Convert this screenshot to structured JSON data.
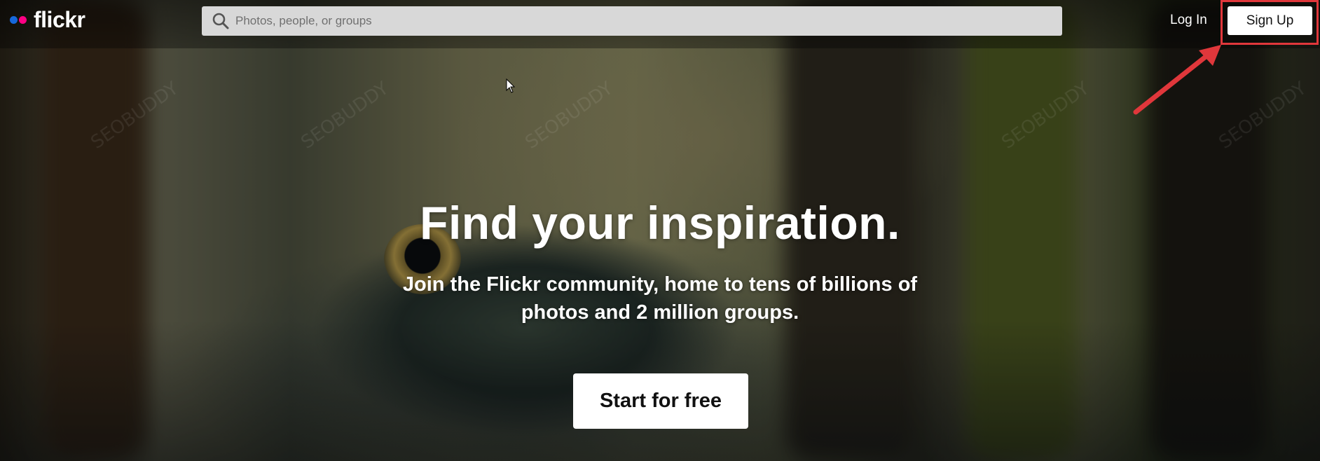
{
  "brand": {
    "name": "flickr",
    "dot_colors": [
      "#1668dc",
      "#ff0084"
    ]
  },
  "search": {
    "placeholder": "Photos, people, or groups"
  },
  "nav": {
    "login_label": "Log In",
    "signup_label": "Sign Up"
  },
  "hero": {
    "title": "Find your inspiration.",
    "subtitle_line1": "Join the Flickr community, home to tens of billions of",
    "subtitle_line2": "photos and 2 million groups.",
    "cta_label": "Start for free"
  },
  "annotation": {
    "color": "#e0373b"
  },
  "watermark": {
    "text": "SEOBUDDY"
  }
}
